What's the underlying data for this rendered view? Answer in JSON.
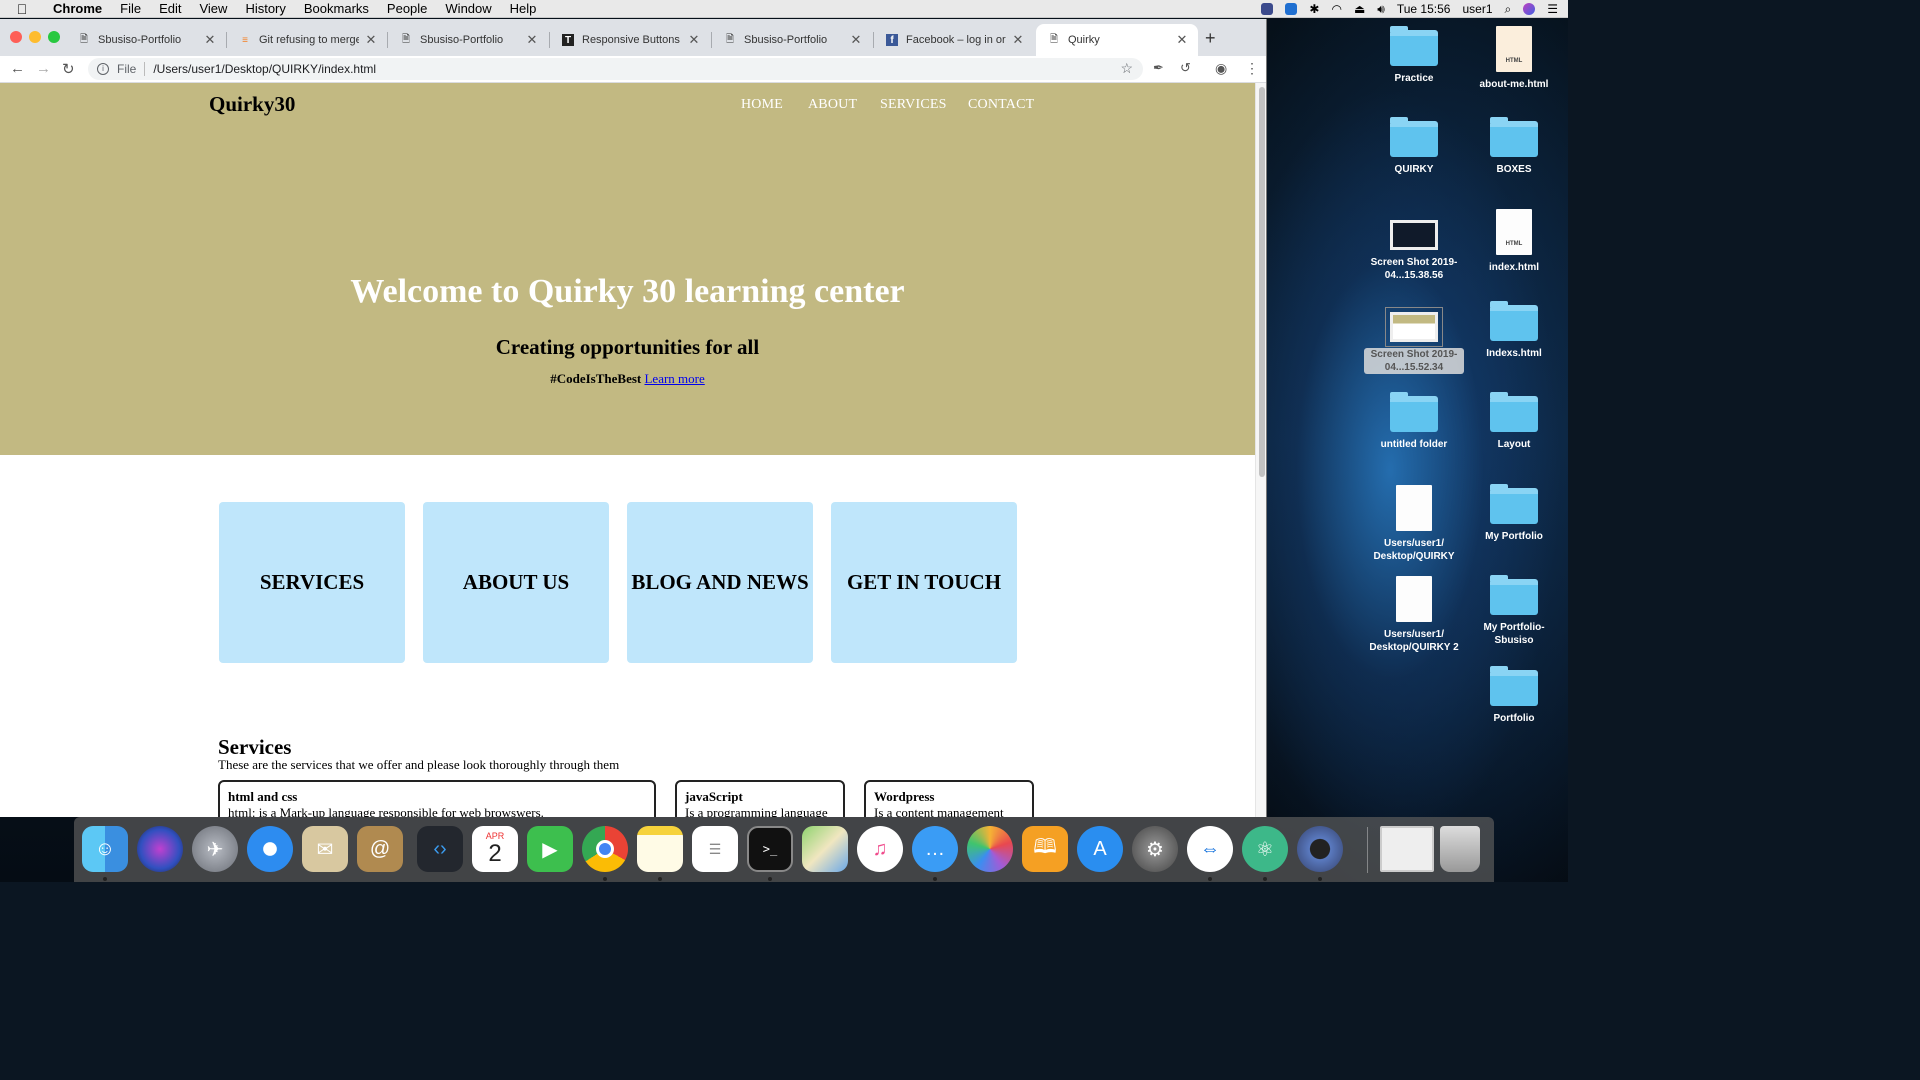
{
  "menubar": {
    "app_name": "Chrome",
    "menus": [
      "File",
      "Edit",
      "View",
      "History",
      "Bookmarks",
      "People",
      "Window",
      "Help"
    ],
    "clock": "Tue 15:56",
    "user": "user1"
  },
  "browser": {
    "tabs": [
      {
        "label": "Sbusiso-Portfolio",
        "icon": "page-icon"
      },
      {
        "label": "Git refusing to merge u",
        "icon": "stackoverflow-icon"
      },
      {
        "label": "Sbusiso-Portfolio",
        "icon": "page-icon"
      },
      {
        "label": "Responsive Buttons wit",
        "icon": "t-logo-icon"
      },
      {
        "label": "Sbusiso-Portfolio",
        "icon": "page-icon"
      },
      {
        "label": "Facebook – log in or sig",
        "icon": "facebook-icon"
      },
      {
        "label": "Quirky",
        "icon": "page-icon"
      }
    ],
    "address": {
      "scheme": "File",
      "url": "/Users/user1/Desktop/QUIRKY/index.html"
    }
  },
  "page": {
    "logo": "Quirky30",
    "nav": [
      "HOME",
      "ABOUT",
      "SERVICES",
      "CONTACT"
    ],
    "hero_title": "Welcome to Quirky 30 learning center",
    "hero_subtitle": "Creating opportunities for all",
    "hashtag": "#CodeIsTheBest",
    "learn_more": "Learn more",
    "cards": [
      "SERVICES",
      "ABOUT US",
      "BLOG AND NEWS",
      "GET IN TOUCH"
    ],
    "services_title": "Services",
    "services_desc": "These are the services that we offer and please look thoroughly through them",
    "services": [
      {
        "title": "html and css",
        "text": "html: is a Mark-up language responsible for web browswers."
      },
      {
        "title": "javaScript",
        "text": "Is a programming language"
      },
      {
        "title": "Wordpress",
        "text": "Is a content management"
      }
    ],
    "colors": {
      "hero_bg": "#c2b982",
      "card_bg": "#bfe6fb"
    }
  },
  "desktop": {
    "icons": [
      {
        "label": "Practice",
        "kind": "folder"
      },
      {
        "label": "about-me.html",
        "kind": "html-file"
      },
      {
        "label": "QUIRKY",
        "kind": "folder"
      },
      {
        "label": "BOXES",
        "kind": "folder"
      },
      {
        "label": "Screen Shot 2019-04...15.38.56",
        "kind": "screenshot"
      },
      {
        "label": "index.html",
        "kind": "html-file"
      },
      {
        "label": "Screen Shot 2019-04...15.52.34",
        "kind": "screenshot"
      },
      {
        "label": "Indexs.html",
        "kind": "folder"
      },
      {
        "label": "untitled folder",
        "kind": "folder"
      },
      {
        "label": "Layout",
        "kind": "folder"
      },
      {
        "label": "Users/user1/ Desktop/QUIRKY",
        "kind": "document"
      },
      {
        "label": "My Portfolio",
        "kind": "folder"
      },
      {
        "label": "Users/user1/ Desktop/QUIRKY 2",
        "kind": "document"
      },
      {
        "label": "My Portfolio- Sbusiso",
        "kind": "folder"
      },
      {
        "label": "Portfolio",
        "kind": "folder"
      }
    ]
  },
  "dock": {
    "apps": [
      "finder-icon",
      "siri-icon",
      "launchpad-icon",
      "safari-icon",
      "mail-icon",
      "contacts-icon",
      "vscode-icon",
      "calendar-icon",
      "facetime-icon",
      "chrome-icon",
      "notes-icon",
      "reminders-icon",
      "terminal-icon",
      "maps-icon",
      "itunes-icon",
      "messages-icon",
      "photos-icon",
      "books-icon",
      "app-store-icon",
      "system-preferences-icon",
      "teamviewer-icon",
      "atom-icon",
      "unknown-app-icon",
      "screenshot-stack-icon",
      "trash-icon"
    ],
    "calendar_month": "APR",
    "calendar_day": "2"
  }
}
